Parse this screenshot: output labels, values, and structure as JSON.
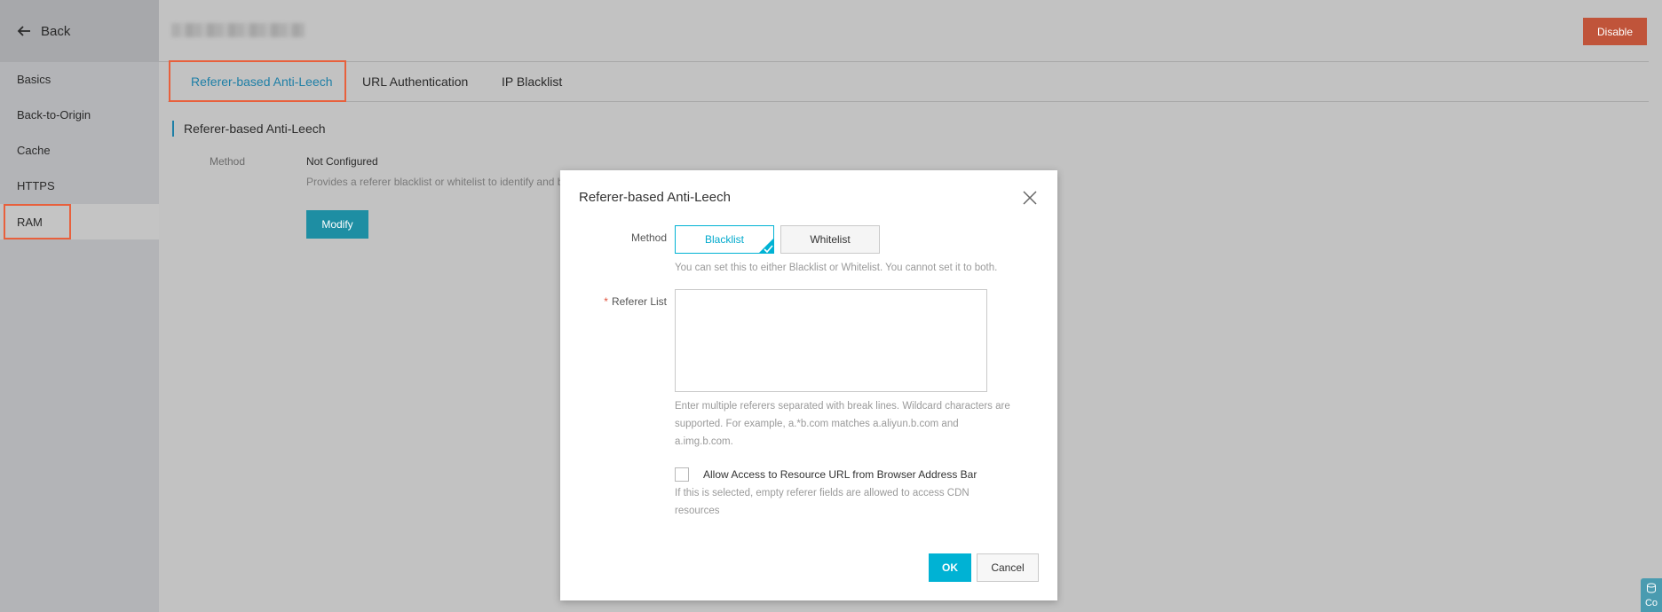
{
  "sidebar": {
    "back_label": "Back",
    "items": [
      {
        "label": "Basics"
      },
      {
        "label": "Back-to-Origin"
      },
      {
        "label": "Cache"
      },
      {
        "label": "HTTPS"
      },
      {
        "label": "RAM"
      }
    ]
  },
  "header": {
    "disable_label": "Disable"
  },
  "tabs": [
    {
      "label": "Referer-based Anti-Leech"
    },
    {
      "label": "URL Authentication"
    },
    {
      "label": "IP Blacklist"
    }
  ],
  "section": {
    "title": "Referer-based Anti-Leech",
    "method_label": "Method",
    "method_value": "Not Configured",
    "description": "Provides a referer blacklist or whitelist to identify and b",
    "modify_label": "Modify"
  },
  "modal": {
    "title": "Referer-based Anti-Leech",
    "method_label": "Method",
    "blacklist_label": "Blacklist",
    "whitelist_label": "Whitelist",
    "method_hint": "You can set this to either Blacklist or Whitelist. You cannot set it to both.",
    "referer_label": "Referer List",
    "referer_value": "",
    "referer_hint_1": "Enter multiple referers separated with break lines. Wildcard characters are",
    "referer_hint_2": "supported. For example, a.*b.com matches a.aliyun.b.com and",
    "referer_hint_3": "a.img.b.com.",
    "allow_label": "Allow Access to Resource URL from Browser Address Bar",
    "allow_hint_1": "If this is selected, empty referer fields are allowed to access CDN",
    "allow_hint_2": "resources",
    "ok_label": "OK",
    "cancel_label": "Cancel"
  },
  "widget": {
    "label": "Co"
  },
  "colors": {
    "accent": "#00b2d4",
    "danger": "#c0543a",
    "highlight": "#e8603c",
    "primary_dark": "#1e8ea3"
  }
}
